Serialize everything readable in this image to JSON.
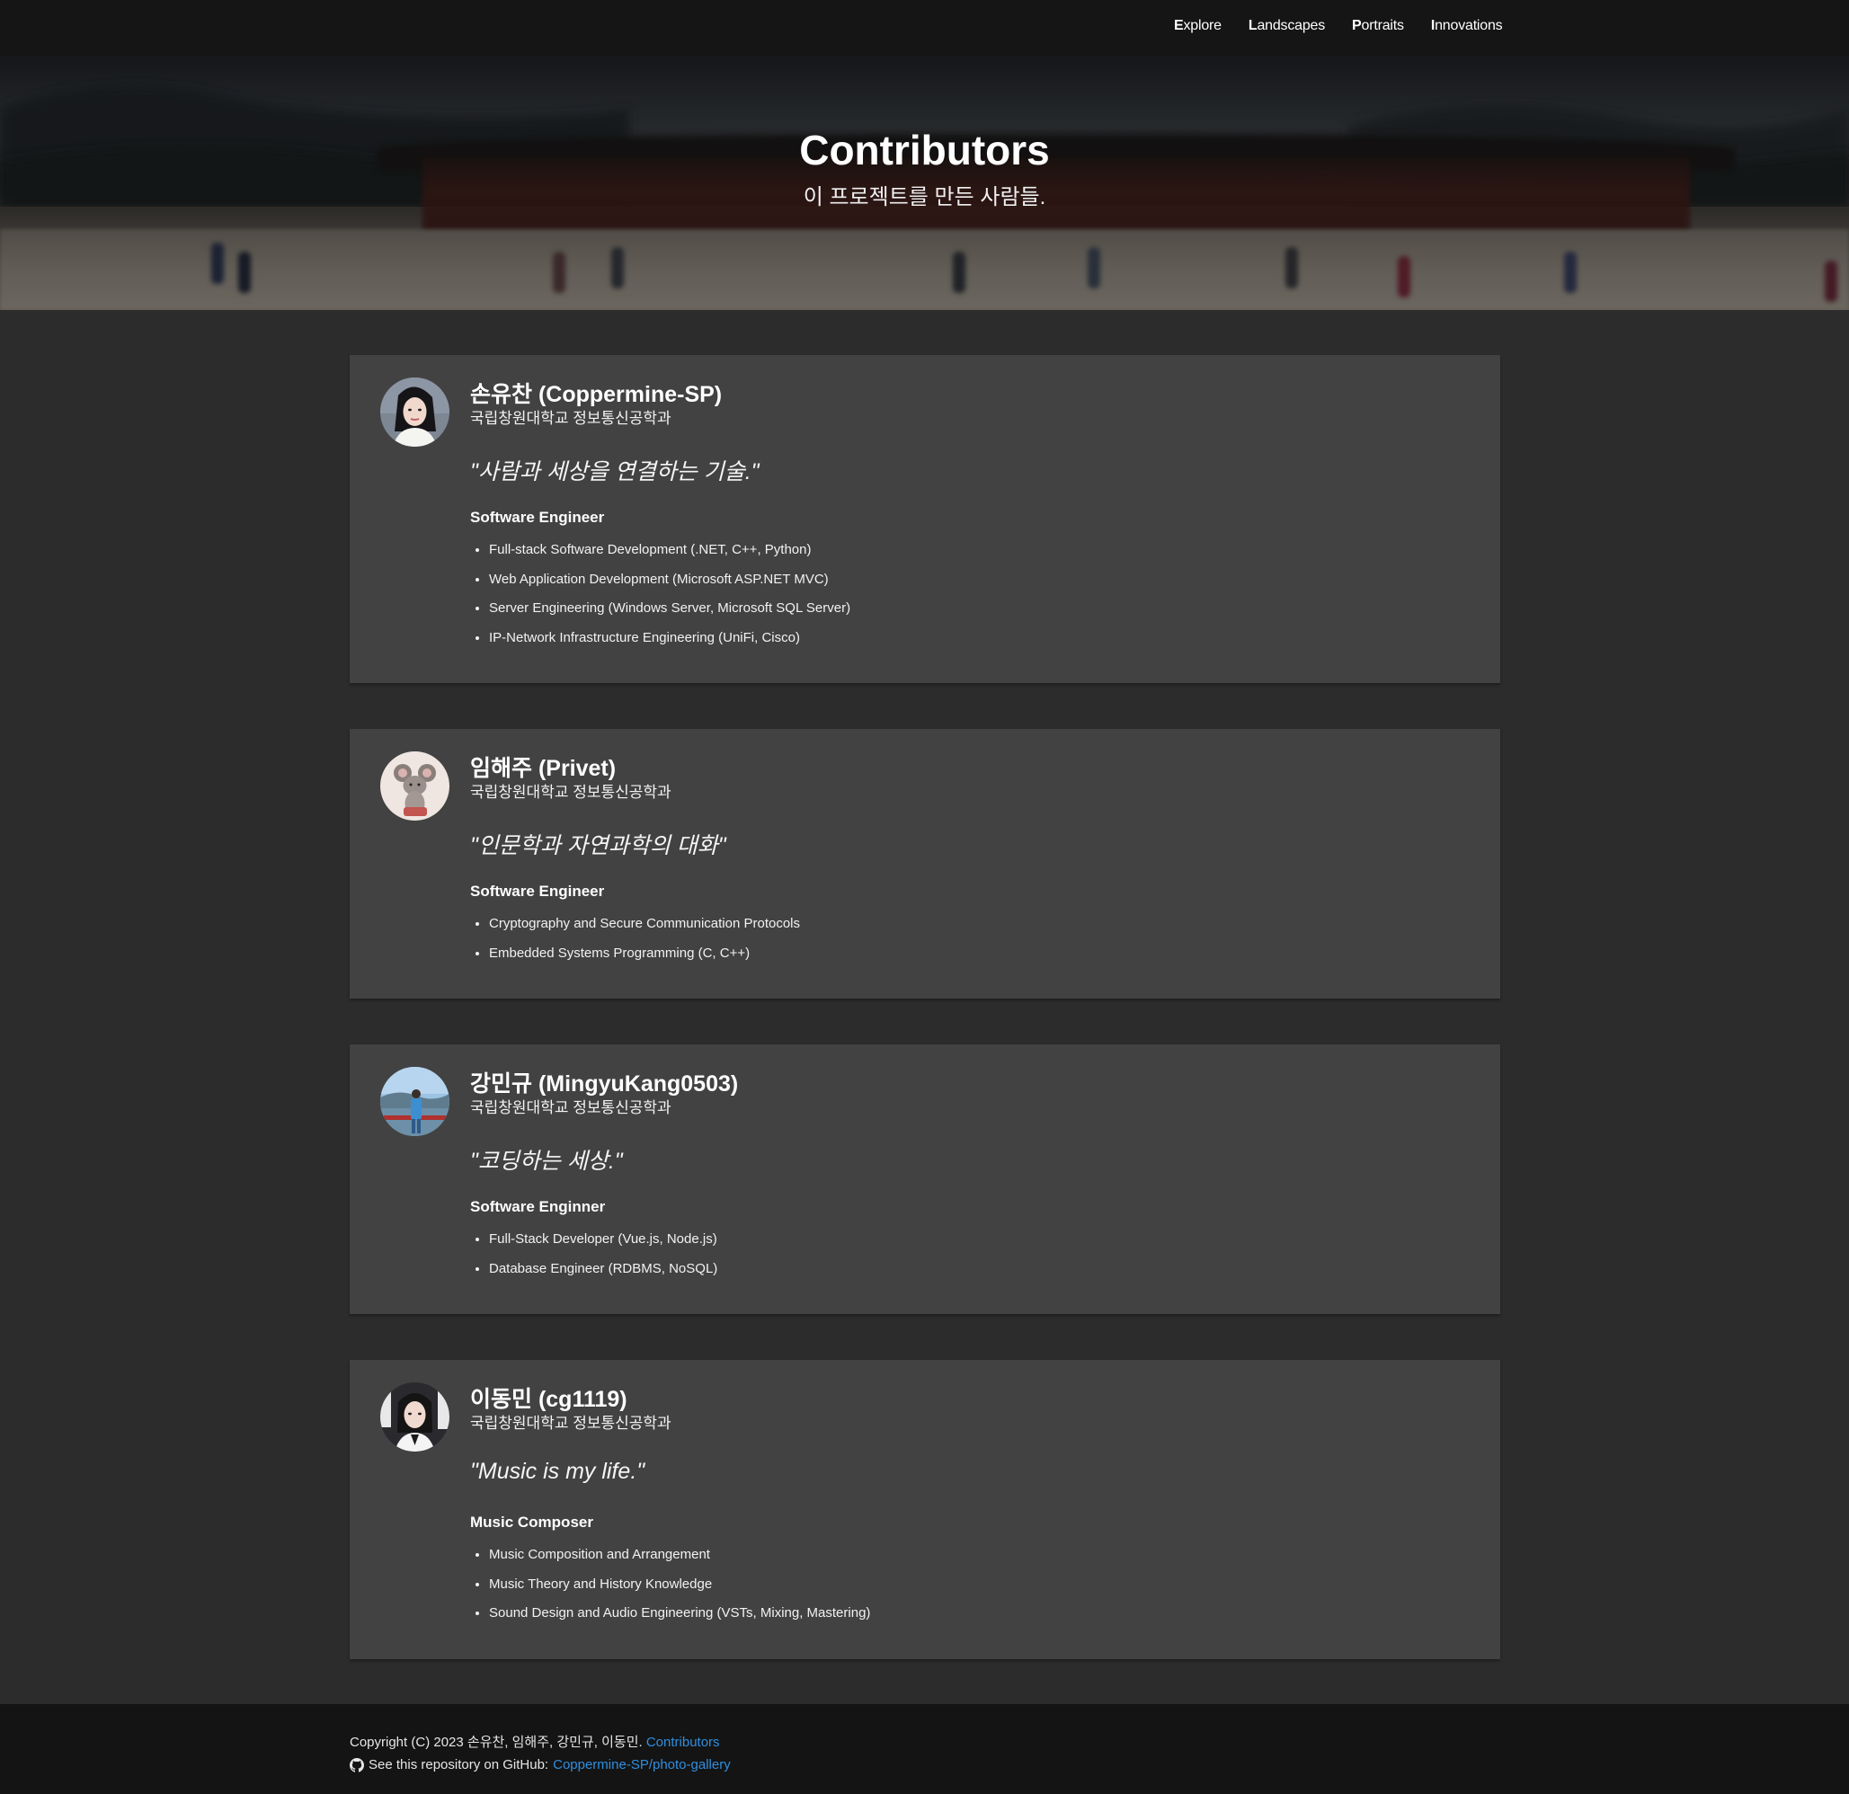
{
  "nav": {
    "items": [
      {
        "cap": "E",
        "rest": "xplore"
      },
      {
        "cap": "L",
        "rest": "andscapes"
      },
      {
        "cap": "P",
        "rest": "ortraits"
      },
      {
        "cap": "I",
        "rest": "nnovations"
      }
    ]
  },
  "hero": {
    "title": "Contributors",
    "subtitle": "이 프로젝트를 만든 사람들."
  },
  "contributors": [
    {
      "name": "손유찬 (Coppermine-SP)",
      "school": "국립창원대학교 정보통신공학과",
      "quote": "\"사람과 세상을 연결하는 기술.\"",
      "role": "Software Engineer",
      "skills": [
        "Full-stack Software Development (.NET, C++, Python)",
        "Web Application Development (Microsoft ASP.NET MVC)",
        "Server Engineering (Windows Server, Microsoft SQL Server)",
        "IP-Network Infrastructure Engineering (UniFi, Cisco)"
      ]
    },
    {
      "name": "임해주 (Privet)",
      "school": "국립창원대학교 정보통신공학과",
      "quote": "\"인문학과 자연과학의 대화\"",
      "role": "Software Engineer",
      "skills": [
        "Cryptography and Secure Communication Protocols",
        "Embedded Systems Programming (C, C++)"
      ]
    },
    {
      "name": "강민규 (MingyuKang0503)",
      "school": "국립창원대학교 정보통신공학과",
      "quote": "\"코딩하는 세상.\"",
      "role": "Software Enginner",
      "skills": [
        "Full-Stack Developer (Vue.js, Node.js)",
        "Database Engineer (RDBMS, NoSQL)"
      ]
    },
    {
      "name": "이동민 (cg1119)",
      "school": "국립창원대학교 정보통신공학과",
      "quote": "\"Music is my life.\"",
      "role": "Music Composer",
      "skills": [
        "Music Composition and Arrangement",
        "Music Theory and History Knowledge",
        "Sound Design and Audio Engineering (VSTs, Mixing, Mastering)"
      ]
    }
  ],
  "footer": {
    "copyright": "Copyright (C) 2023 손유찬, 임해주, 강민규, 이동민.",
    "contributors_link": "Contributors",
    "repo_prefix": "See this repository on GitHub:",
    "repo_link": "Coppermine-SP/photo-gallery"
  },
  "colors": {
    "page_bg": "#2c2c2c",
    "card_bg": "#424242",
    "topbar_bg": "#151515",
    "footer_bg": "#141414",
    "link": "#2f8fe0"
  },
  "icons": [
    "github-icon"
  ]
}
